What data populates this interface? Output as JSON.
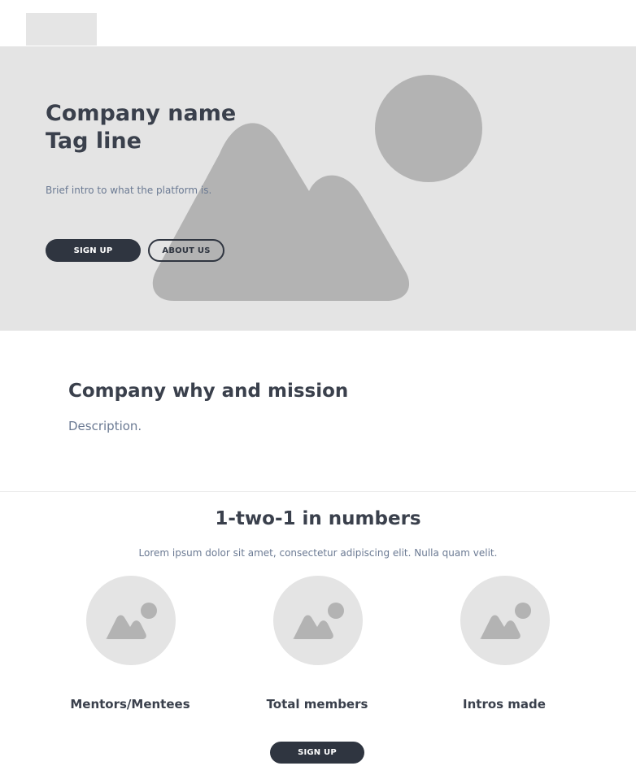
{
  "header": {
    "logo_icon": "logo-placeholder"
  },
  "hero": {
    "title_line1": "Company name",
    "title_line2": "Tag line",
    "intro": "Brief intro to what the platform is.",
    "signup_label": "SIGN UP",
    "about_label": "ABOUT US",
    "image_icon": "image-placeholder-icon"
  },
  "mission": {
    "title": "Company why and mission",
    "description": "Description."
  },
  "numbers": {
    "title": "1-two-1 in numbers",
    "lead": "Lorem ipsum dolor sit amet, consectetur adipiscing elit. Nulla quam velit.",
    "stats": [
      {
        "label": "Mentors/Mentees",
        "icon": "image-placeholder-icon"
      },
      {
        "label": "Total members",
        "icon": "image-placeholder-icon"
      },
      {
        "label": "Intros made",
        "icon": "image-placeholder-icon"
      }
    ],
    "signup_label": "SIGN UP"
  },
  "colors": {
    "hero_bg": "#e4e4e4",
    "placeholder_shape": "#b3b3b3",
    "button_dark": "#2f3540",
    "heading": "#3a404c",
    "body_text": "#6b7a93"
  }
}
